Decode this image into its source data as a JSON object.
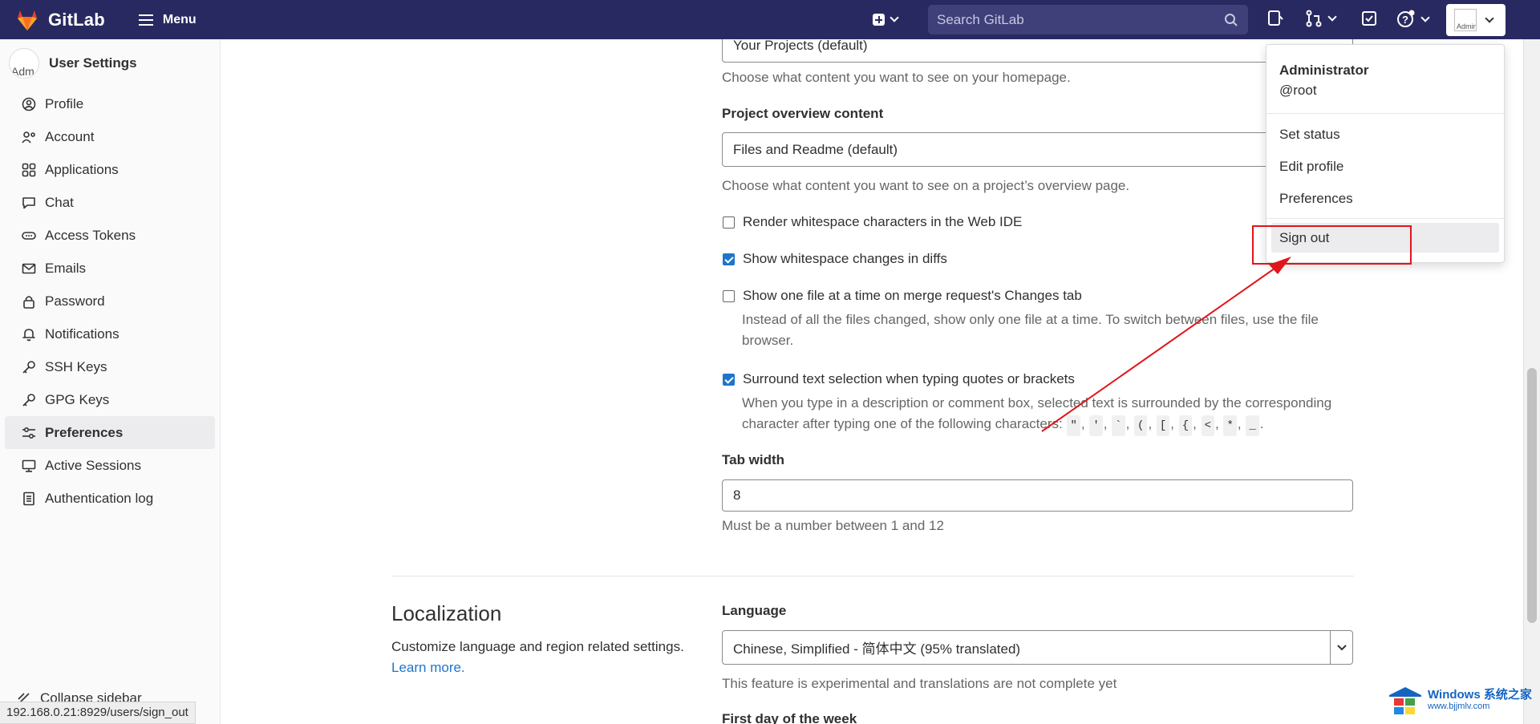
{
  "navbar": {
    "brand": "GitLab",
    "menu_label": "Menu",
    "search_placeholder": "Search GitLab",
    "avatar_alt": "Administ"
  },
  "sidebar": {
    "avatar_alt": "Adm",
    "title": "User Settings",
    "items": [
      {
        "label": "Profile",
        "icon": "profile-icon"
      },
      {
        "label": "Account",
        "icon": "account-icon"
      },
      {
        "label": "Applications",
        "icon": "applications-icon"
      },
      {
        "label": "Chat",
        "icon": "chat-icon"
      },
      {
        "label": "Access Tokens",
        "icon": "token-icon"
      },
      {
        "label": "Emails",
        "icon": "mail-icon"
      },
      {
        "label": "Password",
        "icon": "lock-icon"
      },
      {
        "label": "Notifications",
        "icon": "bell-icon"
      },
      {
        "label": "SSH Keys",
        "icon": "key-icon"
      },
      {
        "label": "GPG Keys",
        "icon": "key-icon"
      },
      {
        "label": "Preferences",
        "icon": "preferences-icon",
        "active": true
      },
      {
        "label": "Active Sessions",
        "icon": "monitor-icon"
      },
      {
        "label": "Authentication log",
        "icon": "log-icon"
      }
    ],
    "collapse_label": "Collapse sidebar"
  },
  "status_bar_url": "192.168.0.21:8929/users/sign_out",
  "main": {
    "homepage_select": "Your Projects (default)",
    "homepage_help": "Choose what content you want to see on your homepage.",
    "project_overview_label": "Project overview content",
    "project_overview_select": "Files and Readme (default)",
    "project_overview_help": "Choose what content you want to see on a project’s overview page.",
    "checkboxes": [
      {
        "label": "Render whitespace characters in the Web IDE",
        "checked": false
      },
      {
        "label": "Show whitespace changes in diffs",
        "checked": true
      },
      {
        "label": "Show one file at a time on merge request's Changes tab",
        "checked": false,
        "help": "Instead of all the files changed, show only one file at a time. To switch between files, use the file browser."
      },
      {
        "label": "Surround text selection when typing quotes or brackets",
        "checked": true,
        "help": "When you type in a description or comment box, selected text is surrounded by the corresponding character after typing one of the following characters:"
      }
    ],
    "surround_chars": [
      "\"",
      "'",
      "`",
      "(",
      "[",
      "{",
      "<",
      "*",
      "_"
    ],
    "tab_width_label": "Tab width",
    "tab_width_value": "8",
    "tab_width_help": "Must be a number between 1 and 12",
    "localization_title": "Localization",
    "localization_desc": "Customize language and region related settings.",
    "learn_more": "Learn more.",
    "language_label": "Language",
    "language_select": "Chinese, Simplified - 简体中文 (95% translated)",
    "language_help": "This feature is experimental and translations are not complete yet",
    "first_day_label": "First day of the week"
  },
  "dropdown": {
    "name": "Administrator",
    "handle": "@root",
    "items": [
      "Set status",
      "Edit profile",
      "Preferences"
    ],
    "sign_out": "Sign out"
  },
  "watermark": {
    "line1": "Windows 系统之家",
    "line2": "www.bjjmlv.com"
  },
  "colors": {
    "navbar": "#292961",
    "accent": "#1f75cb",
    "annotation": "#e0151b"
  }
}
